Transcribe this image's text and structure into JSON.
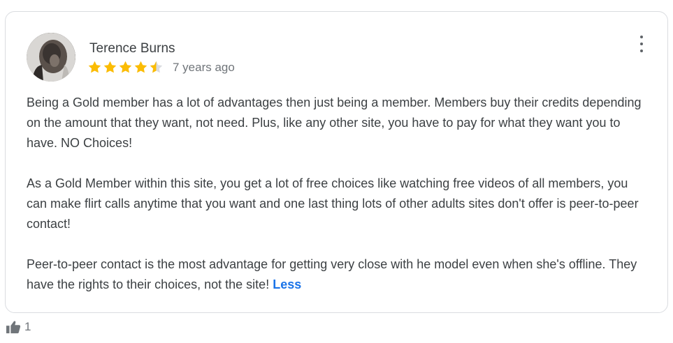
{
  "review": {
    "author_name": "Terence Burns",
    "rating": 4.5,
    "max_rating": 5,
    "time_ago": "7 years ago",
    "paragraphs": [
      "Being a Gold member has a lot of advantages then just being a member. Members buy their credits depending on the amount that they want, not need. Plus, like any other site, you have to pay for what they want you to have. NO Choices!",
      "As a Gold Member within this site, you get a lot of free choices like watching free videos of all members, you can make flirt calls anytime that you want and one last thing lots of other adults sites don't offer is peer-to-peer contact!",
      "Peer-to-peer contact is the most advantage for getting very close with he model even when she's offline. They have the rights to their choices, not the site!"
    ],
    "less_label": "Less",
    "like_count": "1"
  },
  "icons": {
    "menu": "more-vertical-icon",
    "like": "thumbs-up-icon",
    "star": "star-icon"
  },
  "colors": {
    "star": "#fbbc04",
    "star_empty": "#dadce0",
    "link": "#1a73e8",
    "text": "#3c4043",
    "muted": "#70757a"
  }
}
